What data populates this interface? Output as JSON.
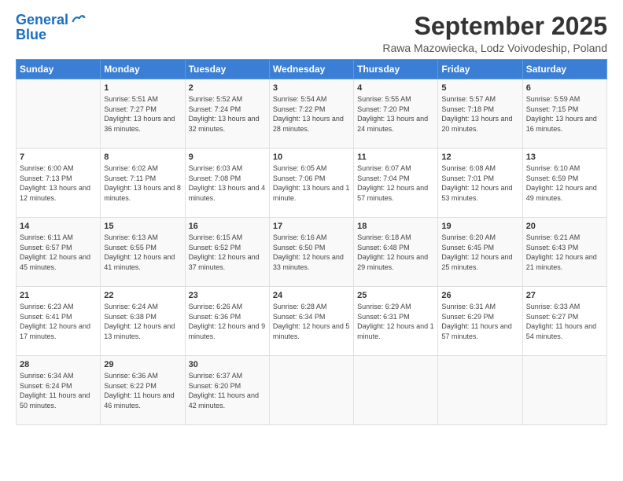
{
  "header": {
    "logo_line1": "General",
    "logo_line2": "Blue",
    "month": "September 2025",
    "location": "Rawa Mazowiecka, Lodz Voivodeship, Poland"
  },
  "days_of_week": [
    "Sunday",
    "Monday",
    "Tuesday",
    "Wednesday",
    "Thursday",
    "Friday",
    "Saturday"
  ],
  "weeks": [
    [
      {
        "day": "",
        "sunrise": "",
        "sunset": "",
        "daylight": ""
      },
      {
        "day": "1",
        "sunrise": "Sunrise: 5:51 AM",
        "sunset": "Sunset: 7:27 PM",
        "daylight": "Daylight: 13 hours and 36 minutes."
      },
      {
        "day": "2",
        "sunrise": "Sunrise: 5:52 AM",
        "sunset": "Sunset: 7:24 PM",
        "daylight": "Daylight: 13 hours and 32 minutes."
      },
      {
        "day": "3",
        "sunrise": "Sunrise: 5:54 AM",
        "sunset": "Sunset: 7:22 PM",
        "daylight": "Daylight: 13 hours and 28 minutes."
      },
      {
        "day": "4",
        "sunrise": "Sunrise: 5:55 AM",
        "sunset": "Sunset: 7:20 PM",
        "daylight": "Daylight: 13 hours and 24 minutes."
      },
      {
        "day": "5",
        "sunrise": "Sunrise: 5:57 AM",
        "sunset": "Sunset: 7:18 PM",
        "daylight": "Daylight: 13 hours and 20 minutes."
      },
      {
        "day": "6",
        "sunrise": "Sunrise: 5:59 AM",
        "sunset": "Sunset: 7:15 PM",
        "daylight": "Daylight: 13 hours and 16 minutes."
      }
    ],
    [
      {
        "day": "7",
        "sunrise": "Sunrise: 6:00 AM",
        "sunset": "Sunset: 7:13 PM",
        "daylight": "Daylight: 13 hours and 12 minutes."
      },
      {
        "day": "8",
        "sunrise": "Sunrise: 6:02 AM",
        "sunset": "Sunset: 7:11 PM",
        "daylight": "Daylight: 13 hours and 8 minutes."
      },
      {
        "day": "9",
        "sunrise": "Sunrise: 6:03 AM",
        "sunset": "Sunset: 7:08 PM",
        "daylight": "Daylight: 13 hours and 4 minutes."
      },
      {
        "day": "10",
        "sunrise": "Sunrise: 6:05 AM",
        "sunset": "Sunset: 7:06 PM",
        "daylight": "Daylight: 13 hours and 1 minute."
      },
      {
        "day": "11",
        "sunrise": "Sunrise: 6:07 AM",
        "sunset": "Sunset: 7:04 PM",
        "daylight": "Daylight: 12 hours and 57 minutes."
      },
      {
        "day": "12",
        "sunrise": "Sunrise: 6:08 AM",
        "sunset": "Sunset: 7:01 PM",
        "daylight": "Daylight: 12 hours and 53 minutes."
      },
      {
        "day": "13",
        "sunrise": "Sunrise: 6:10 AM",
        "sunset": "Sunset: 6:59 PM",
        "daylight": "Daylight: 12 hours and 49 minutes."
      }
    ],
    [
      {
        "day": "14",
        "sunrise": "Sunrise: 6:11 AM",
        "sunset": "Sunset: 6:57 PM",
        "daylight": "Daylight: 12 hours and 45 minutes."
      },
      {
        "day": "15",
        "sunrise": "Sunrise: 6:13 AM",
        "sunset": "Sunset: 6:55 PM",
        "daylight": "Daylight: 12 hours and 41 minutes."
      },
      {
        "day": "16",
        "sunrise": "Sunrise: 6:15 AM",
        "sunset": "Sunset: 6:52 PM",
        "daylight": "Daylight: 12 hours and 37 minutes."
      },
      {
        "day": "17",
        "sunrise": "Sunrise: 6:16 AM",
        "sunset": "Sunset: 6:50 PM",
        "daylight": "Daylight: 12 hours and 33 minutes."
      },
      {
        "day": "18",
        "sunrise": "Sunrise: 6:18 AM",
        "sunset": "Sunset: 6:48 PM",
        "daylight": "Daylight: 12 hours and 29 minutes."
      },
      {
        "day": "19",
        "sunrise": "Sunrise: 6:20 AM",
        "sunset": "Sunset: 6:45 PM",
        "daylight": "Daylight: 12 hours and 25 minutes."
      },
      {
        "day": "20",
        "sunrise": "Sunrise: 6:21 AM",
        "sunset": "Sunset: 6:43 PM",
        "daylight": "Daylight: 12 hours and 21 minutes."
      }
    ],
    [
      {
        "day": "21",
        "sunrise": "Sunrise: 6:23 AM",
        "sunset": "Sunset: 6:41 PM",
        "daylight": "Daylight: 12 hours and 17 minutes."
      },
      {
        "day": "22",
        "sunrise": "Sunrise: 6:24 AM",
        "sunset": "Sunset: 6:38 PM",
        "daylight": "Daylight: 12 hours and 13 minutes."
      },
      {
        "day": "23",
        "sunrise": "Sunrise: 6:26 AM",
        "sunset": "Sunset: 6:36 PM",
        "daylight": "Daylight: 12 hours and 9 minutes."
      },
      {
        "day": "24",
        "sunrise": "Sunrise: 6:28 AM",
        "sunset": "Sunset: 6:34 PM",
        "daylight": "Daylight: 12 hours and 5 minutes."
      },
      {
        "day": "25",
        "sunrise": "Sunrise: 6:29 AM",
        "sunset": "Sunset: 6:31 PM",
        "daylight": "Daylight: 12 hours and 1 minute."
      },
      {
        "day": "26",
        "sunrise": "Sunrise: 6:31 AM",
        "sunset": "Sunset: 6:29 PM",
        "daylight": "Daylight: 11 hours and 57 minutes."
      },
      {
        "day": "27",
        "sunrise": "Sunrise: 6:33 AM",
        "sunset": "Sunset: 6:27 PM",
        "daylight": "Daylight: 11 hours and 54 minutes."
      }
    ],
    [
      {
        "day": "28",
        "sunrise": "Sunrise: 6:34 AM",
        "sunset": "Sunset: 6:24 PM",
        "daylight": "Daylight: 11 hours and 50 minutes."
      },
      {
        "day": "29",
        "sunrise": "Sunrise: 6:36 AM",
        "sunset": "Sunset: 6:22 PM",
        "daylight": "Daylight: 11 hours and 46 minutes."
      },
      {
        "day": "30",
        "sunrise": "Sunrise: 6:37 AM",
        "sunset": "Sunset: 6:20 PM",
        "daylight": "Daylight: 11 hours and 42 minutes."
      },
      {
        "day": "",
        "sunrise": "",
        "sunset": "",
        "daylight": ""
      },
      {
        "day": "",
        "sunrise": "",
        "sunset": "",
        "daylight": ""
      },
      {
        "day": "",
        "sunrise": "",
        "sunset": "",
        "daylight": ""
      },
      {
        "day": "",
        "sunrise": "",
        "sunset": "",
        "daylight": ""
      }
    ]
  ]
}
